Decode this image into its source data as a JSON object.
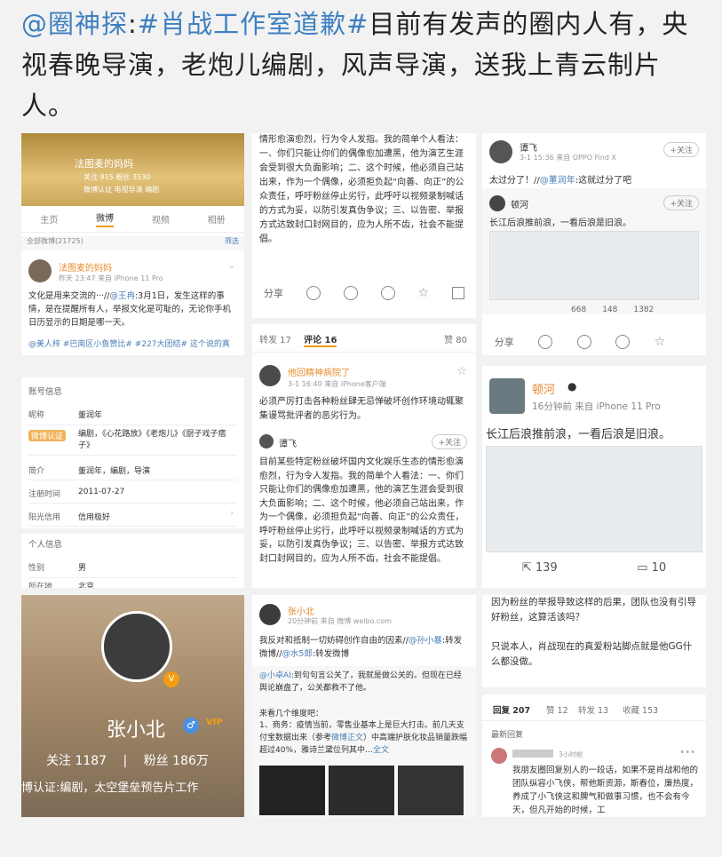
{
  "headline": {
    "prefix": "@圈神探",
    "colon": ":",
    "tag": "#肖战工作室道歉#",
    "text": "目前有发声的圈内人有，央视春晚导演，老炮儿编剧，风声导演，送我上青云制片人。"
  },
  "p1": {
    "name": "法图麦的妈妈",
    "stats": "关注 915  粉丝 3530",
    "bio": "微博认证 电视导演 编剧",
    "tabs": [
      "主页",
      "微博",
      "视频",
      "相册"
    ],
    "all_weibo": "全部微博(21725)",
    "filter": "筛选",
    "post_name": "法图麦的妈妈",
    "post_time": "昨天 23:47  来自 iPhone 11 Pro",
    "post_text_1": "文化是用来交流的···//",
    "post_mention": "@王冉",
    "post_text_2": ":3月1日，发生这样的事情，是在提醒所有人，举报文化是可耻的，无论你手机日历显示的日期是哪一天。",
    "post_link": "@美人梓 #巴南区小鱼赞比# #227大团结# 这个说的真"
  },
  "p2": {
    "text": "情形愈演愈烈，行为令人发指。我的简单个人看法：一、你们只能让你们的偶像愈加遭黑，他为演艺生涯会受到很大负面影响；二、这个时候，他必须自己站出来，作为一个偶像，必须拒负起“向善、向正”的公众责任，呼吁粉丝停止劣行，此呼吁以视频录制喊话的方式为妥，以防引发真伪争议；三、以告密、举报方式达致封口封网目的，应为人所不齿，社会不能提倡。",
    "share": "分享"
  },
  "p3": {
    "name": "谭飞",
    "time": "3-1 15:36  来自 OPPO Find X",
    "follow": "+关注",
    "text_1": "太过分了！//",
    "mention": "@董润年",
    "text_2": ":这就过分了吧",
    "inner_name": "顿河",
    "inner_follow": "+关注",
    "inner_text": "长江后浪推前浪，一看后浪是旧浪。",
    "stats": [
      "668",
      "148",
      "1382"
    ],
    "share": "分享"
  },
  "p4": {
    "sections": [
      {
        "title": "账号信息",
        "rows": [
          {
            "k": "昵称",
            "v": "董润年"
          },
          {
            "k": "微博认证",
            "v": "编剧，《心花路放》《老炮儿》《厨子戏子痞子》"
          },
          {
            "k": "简介",
            "v": "董润年，编剧，导演"
          },
          {
            "k": "注册时间",
            "v": "2011-07-27"
          },
          {
            "k": "阳光信用",
            "v": "信用极好"
          }
        ]
      },
      {
        "title": "个人信息",
        "rows": [
          {
            "k": "性别",
            "v": "男"
          },
          {
            "k": "所在地",
            "v": "北京"
          }
        ]
      }
    ]
  },
  "p5": {
    "tabs": {
      "repost": "转发 17",
      "comment": "评论 16",
      "like": "赞 80"
    },
    "c_name": "他回精神病院了",
    "c_time": "3-1 16:40  来自 iPhone客户端",
    "c_text": "必须严厉打击各种粉丝肆无忌惮破坏创作环境动辄聚集谩骂批评者的恶劣行为。",
    "r_name": "谭飞",
    "r_follow": "+关注",
    "r_text": "目前某些特定粉丝破坏国内文化娱乐生态的情形愈演愈烈，行为令人发指。我的简单个人看法：一、你们只能让你们的偶像愈加遭黑，他的演艺生涯会受到很大负面影响；二、这个时候，他必须自己站出来，作为一个偶像，必须担负起“向善、向正”的公众责任，呼吁粉丝停止劣行，此呼吁以视频录制喊话的方式为妥，以防引发真伪争议；三、以告密、举报方式达致封口封网目的，应为人所不齿，社会不能提倡。"
  },
  "p6": {
    "name": "顿河",
    "time": "16分钟前  来自 iPhone 11 Pro",
    "text": "长江后浪推前浪，一看后浪是旧浪。",
    "repost": "139",
    "comment": "10"
  },
  "p7": {
    "name": "张小北",
    "follow": "关注 1187",
    "fans": "粉丝 186万",
    "sep": "|",
    "cert": "博认证:编剧，太空堡垒预告片工作"
  },
  "p8": {
    "name": "张小北",
    "time": "20分钟前  来自 微博 weibo.com",
    "text_1": "我反对和抵制一切妨碍创作自由的因素//",
    "mention_1": "@孙小暴",
    "text_2": ":转发微博",
    "mention_2": "@水5郎",
    "sub_mention": "@小卓AI",
    "sub_text": ":到句句言公关了，我就是做公关的。但现在已经舆论崩盘了，公关都救不了他。",
    "list_title": "来看几个维度吧：",
    "list_1": "1、商务：疫情当前，零售业基本上是巨大打击。前几天支付宝数据出来（参考",
    "list_link": "微博正文",
    "list_2": "）中高端护肤化妆品销量跌幅超过40%，雅诗兰黛位列其中…",
    "full": "全文"
  },
  "p9": {
    "text_1": "因为粉丝的举报导致这样的后果，团队也没有引导好粉丝，这算活该吗？",
    "text_2": "只说本人，肖战现在的真爱粉站脚点就是他GG什么都没做。",
    "tabs": {
      "reply": "回复 207",
      "like": "赞 12",
      "repost": "转发 13",
      "fav": "收藏 153"
    },
    "section": "最新回复",
    "c_time": "3小时前",
    "c_text": "我朋友圈回复别人的一段话，如果不是肖战和他的团队纵容小飞侠，帮他斯资源，斯春位，廉热度，养成了小飞侠这和脾气和做事习惯，也不会有今天，但凡开始的时候，工"
  },
  "colors": {
    "blue": "#3d7fc1",
    "orange": "#e98a2b",
    "bg": "#f2f2f2"
  }
}
